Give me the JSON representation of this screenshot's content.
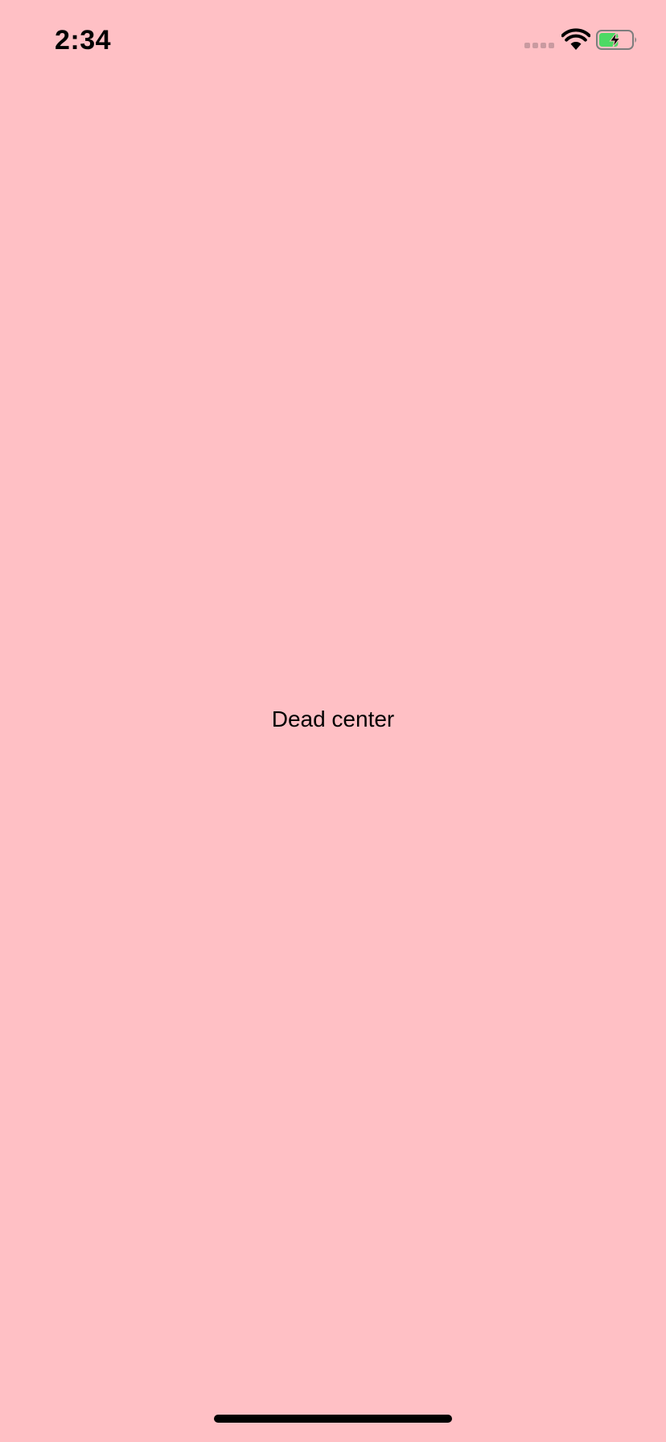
{
  "status_bar": {
    "time": "2:34",
    "signal_icon": "cellular-signal-icon",
    "signal_color": "#c99aa0",
    "wifi_icon": "wifi-icon",
    "battery_icon": "battery-charging-icon",
    "battery_fill_color": "#4cd964",
    "battery_level": 0.6
  },
  "main": {
    "label": "Dead center"
  },
  "colors": {
    "background": "#ffc0c5",
    "text": "#000000",
    "home_indicator": "#000000"
  }
}
